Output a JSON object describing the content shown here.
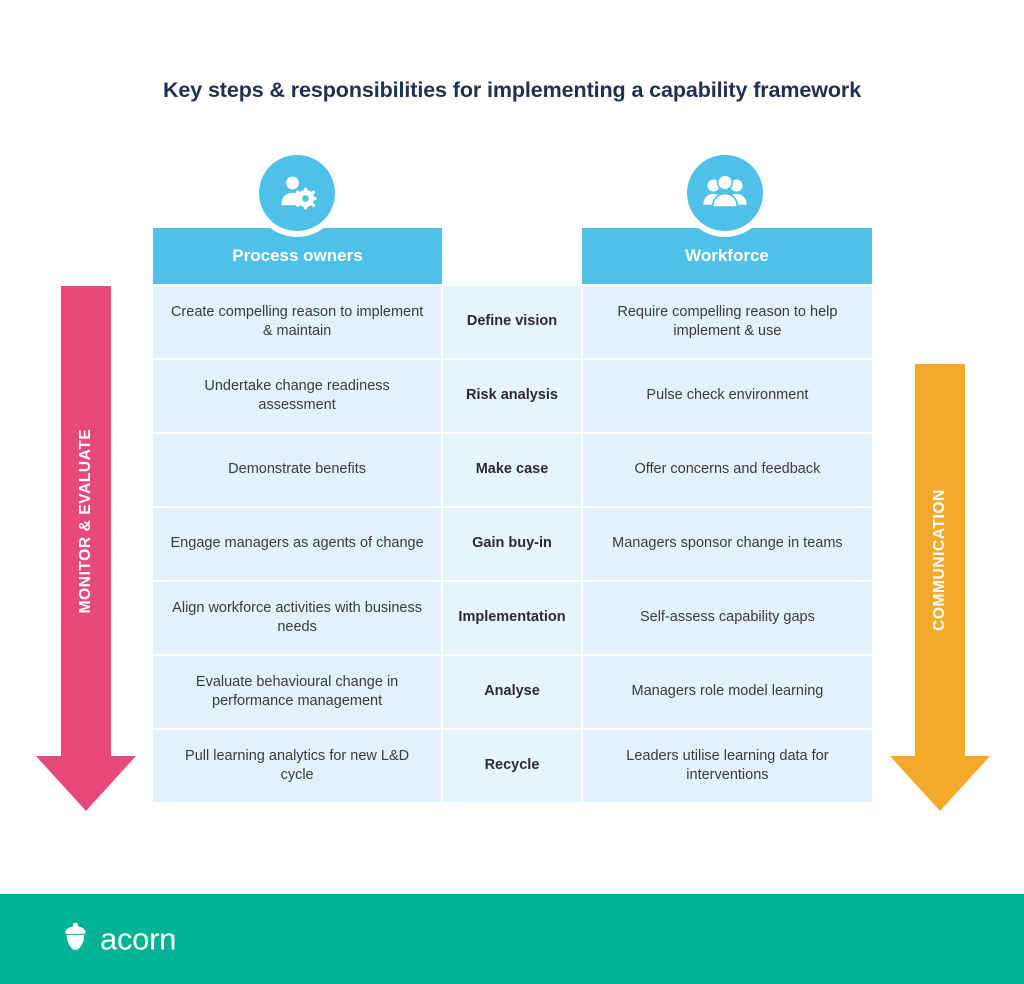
{
  "title": "Key steps & responsibilities for implementing a capability framework",
  "colors": {
    "header_blue": "#4FC0E8",
    "cell_blue": "#E3F2FA",
    "step_blue": "#E8F4FB",
    "title_navy": "#1F3050",
    "arrow_pink": "#E8497A",
    "arrow_orange": "#F5A92B",
    "footer_teal": "#00B394"
  },
  "columns": {
    "owners": {
      "header": "Process owners",
      "icon": "person-gear-icon"
    },
    "steps": {
      "header": ""
    },
    "workforce": {
      "header": "Workforce",
      "icon": "people-group-icon"
    }
  },
  "rows": [
    {
      "owner": "Create compelling reason to implement & maintain",
      "step": "Define vision",
      "workforce": "Require compelling reason to help implement & use"
    },
    {
      "owner": "Undertake change readiness assessment",
      "step": "Risk analysis",
      "workforce": "Pulse check environment"
    },
    {
      "owner": "Demonstrate benefits",
      "step": "Make case",
      "workforce": "Offer concerns and feedback"
    },
    {
      "owner": "Engage managers as agents of change",
      "step": "Gain buy-in",
      "workforce": "Managers sponsor change in teams"
    },
    {
      "owner": "Align workforce activities with business needs",
      "step": "Implementation",
      "workforce": "Self-assess capability gaps"
    },
    {
      "owner": "Evaluate behavioural change in performance management",
      "step": "Analyse",
      "workforce": "Managers role model learning"
    },
    {
      "owner": "Pull learning analytics for new L&D cycle",
      "step": "Recycle",
      "workforce": "Leaders utilise learning data for interventions"
    }
  ],
  "arrows": {
    "left": {
      "label": "MONITOR & EVALUATE",
      "direction": "down"
    },
    "right": {
      "label": "COMMUNICATION",
      "direction": "down"
    }
  },
  "footer": {
    "brand": "acorn",
    "logo": "acorn-icon"
  }
}
